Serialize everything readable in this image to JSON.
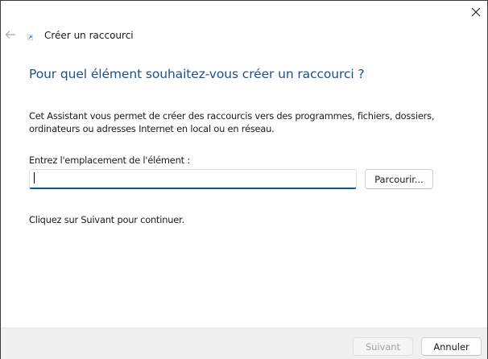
{
  "window": {
    "title": "Créer un raccourci",
    "close_icon": "close-icon",
    "back_icon": "arrow-left-icon",
    "app_icon": "shortcut-icon"
  },
  "main": {
    "heading": "Pour quel élément souhaitez-vous créer un raccourci ?",
    "description": "Cet Assistant vous permet de créer des raccourcis vers des programmes, fichiers, dossiers, ordinateurs ou adresses Internet en local ou en réseau.",
    "location_label": "Entrez l'emplacement de l'élément :",
    "location_value": "",
    "browse_label": "Parcourir...",
    "continue_text": "Cliquez sur Suivant pour continuer."
  },
  "footer": {
    "next_label": "Suivant",
    "next_enabled": false,
    "cancel_label": "Annuler"
  },
  "colors": {
    "heading": "#1c4f91",
    "input_underline": "#005a9e",
    "footer_background": "#f0f0f0",
    "disabled_text": "#a0a0a0"
  }
}
